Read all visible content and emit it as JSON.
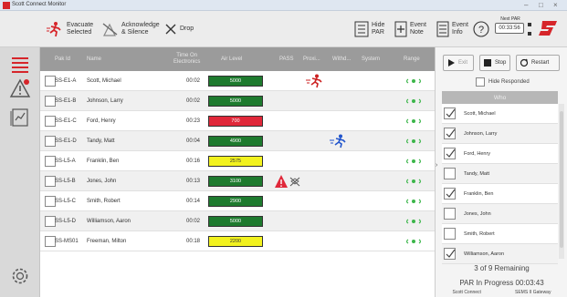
{
  "window": {
    "title": "Scott Connect Monitor",
    "minimize": "–",
    "maximize": "□",
    "close": "×"
  },
  "toolbar": {
    "evacuate_selected": "Evacuate\nSelected",
    "acknowledge_silence": "Acknowledge\n& Silence",
    "drop": "Drop",
    "hide_par": "Hide\nPAR",
    "event_note": "Event\nNote",
    "event_info": "Event\nInfo",
    "next_par_label": "Next PAR",
    "next_par_time": "00:33:56"
  },
  "grid": {
    "headers": {
      "pak_id": "Pak Id",
      "name": "Name",
      "time_on": "Time On\nElectronics",
      "air_level": "Air Level",
      "pass": "PASS",
      "proximity": "Proxi...",
      "withdrawal": "Withd...",
      "system": "System",
      "range": "Range"
    },
    "rows": [
      {
        "pak_id": "SS-E1-A",
        "name": "Scott, Michael",
        "time": "00:02",
        "air": "5000",
        "air_color": "#1e7a2e",
        "evac": true,
        "evac_color": "#cc2222",
        "alarm": false
      },
      {
        "pak_id": "SS-E1-B",
        "name": "Johnson, Larry",
        "time": "00:02",
        "air": "5000",
        "air_color": "#1e7a2e",
        "evac": false,
        "alarm": false
      },
      {
        "pak_id": "SS-E1-C",
        "name": "Ford, Henry",
        "time": "00:23",
        "air": "700",
        "air_color": "#e0283a",
        "evac": false,
        "alarm": false
      },
      {
        "pak_id": "SS-E1-D",
        "name": "Tandy, Matt",
        "time": "00:04",
        "air": "4900",
        "air_color": "#1e7a2e",
        "evac": true,
        "evac_color": "#2255cc",
        "alarm": false
      },
      {
        "pak_id": "SS-L5-A",
        "name": "Franklin, Ben",
        "time": "00:16",
        "air": "2575",
        "air_color": "#f2f21e",
        "evac": false,
        "alarm": false
      },
      {
        "pak_id": "SS-L5-B",
        "name": "Jones, John",
        "time": "00:13",
        "air": "3100",
        "air_color": "#1e7a2e",
        "evac": false,
        "alarm": true
      },
      {
        "pak_id": "SS-L5-C",
        "name": "Smith, Robert",
        "time": "00:14",
        "air": "2900",
        "air_color": "#1e7a2e",
        "evac": false,
        "alarm": false
      },
      {
        "pak_id": "SS-L5-D",
        "name": "Williamson, Aaron",
        "time": "00:02",
        "air": "5000",
        "air_color": "#1e7a2e",
        "evac": false,
        "alarm": false
      },
      {
        "pak_id": "SS-MS01",
        "name": "Freeman, Milton",
        "time": "00:18",
        "air": "2200",
        "air_color": "#f2f21e",
        "evac": false,
        "alarm": false
      }
    ]
  },
  "right_panel": {
    "exit_label": "Exit",
    "stop_label": "Stop",
    "restart_label": "Restart",
    "hide_responded": "Hide Responded",
    "who_header": "Who",
    "who": [
      {
        "name": "Scott, Michael",
        "checked": true
      },
      {
        "name": "Johnson, Larry",
        "checked": true
      },
      {
        "name": "Ford, Henry",
        "checked": true
      },
      {
        "name": "Tandy, Matt",
        "checked": false
      },
      {
        "name": "Franklin, Ben",
        "checked": true
      },
      {
        "name": "Jones, John",
        "checked": false
      },
      {
        "name": "Smith, Robert",
        "checked": false
      },
      {
        "name": "Williamson, Aaron",
        "checked": true
      }
    ],
    "remaining": "3 of 9 Remaining",
    "par_progress": "PAR In Progress  00:03:43",
    "status_left": "Scott Connect",
    "status_right": "SEMS II Gateway"
  },
  "colors": {
    "brand_red": "#d6252a",
    "range_green": "#3cb64a",
    "header_gray": "#9b9b9b",
    "nav_gray": "#d9d9d9"
  }
}
